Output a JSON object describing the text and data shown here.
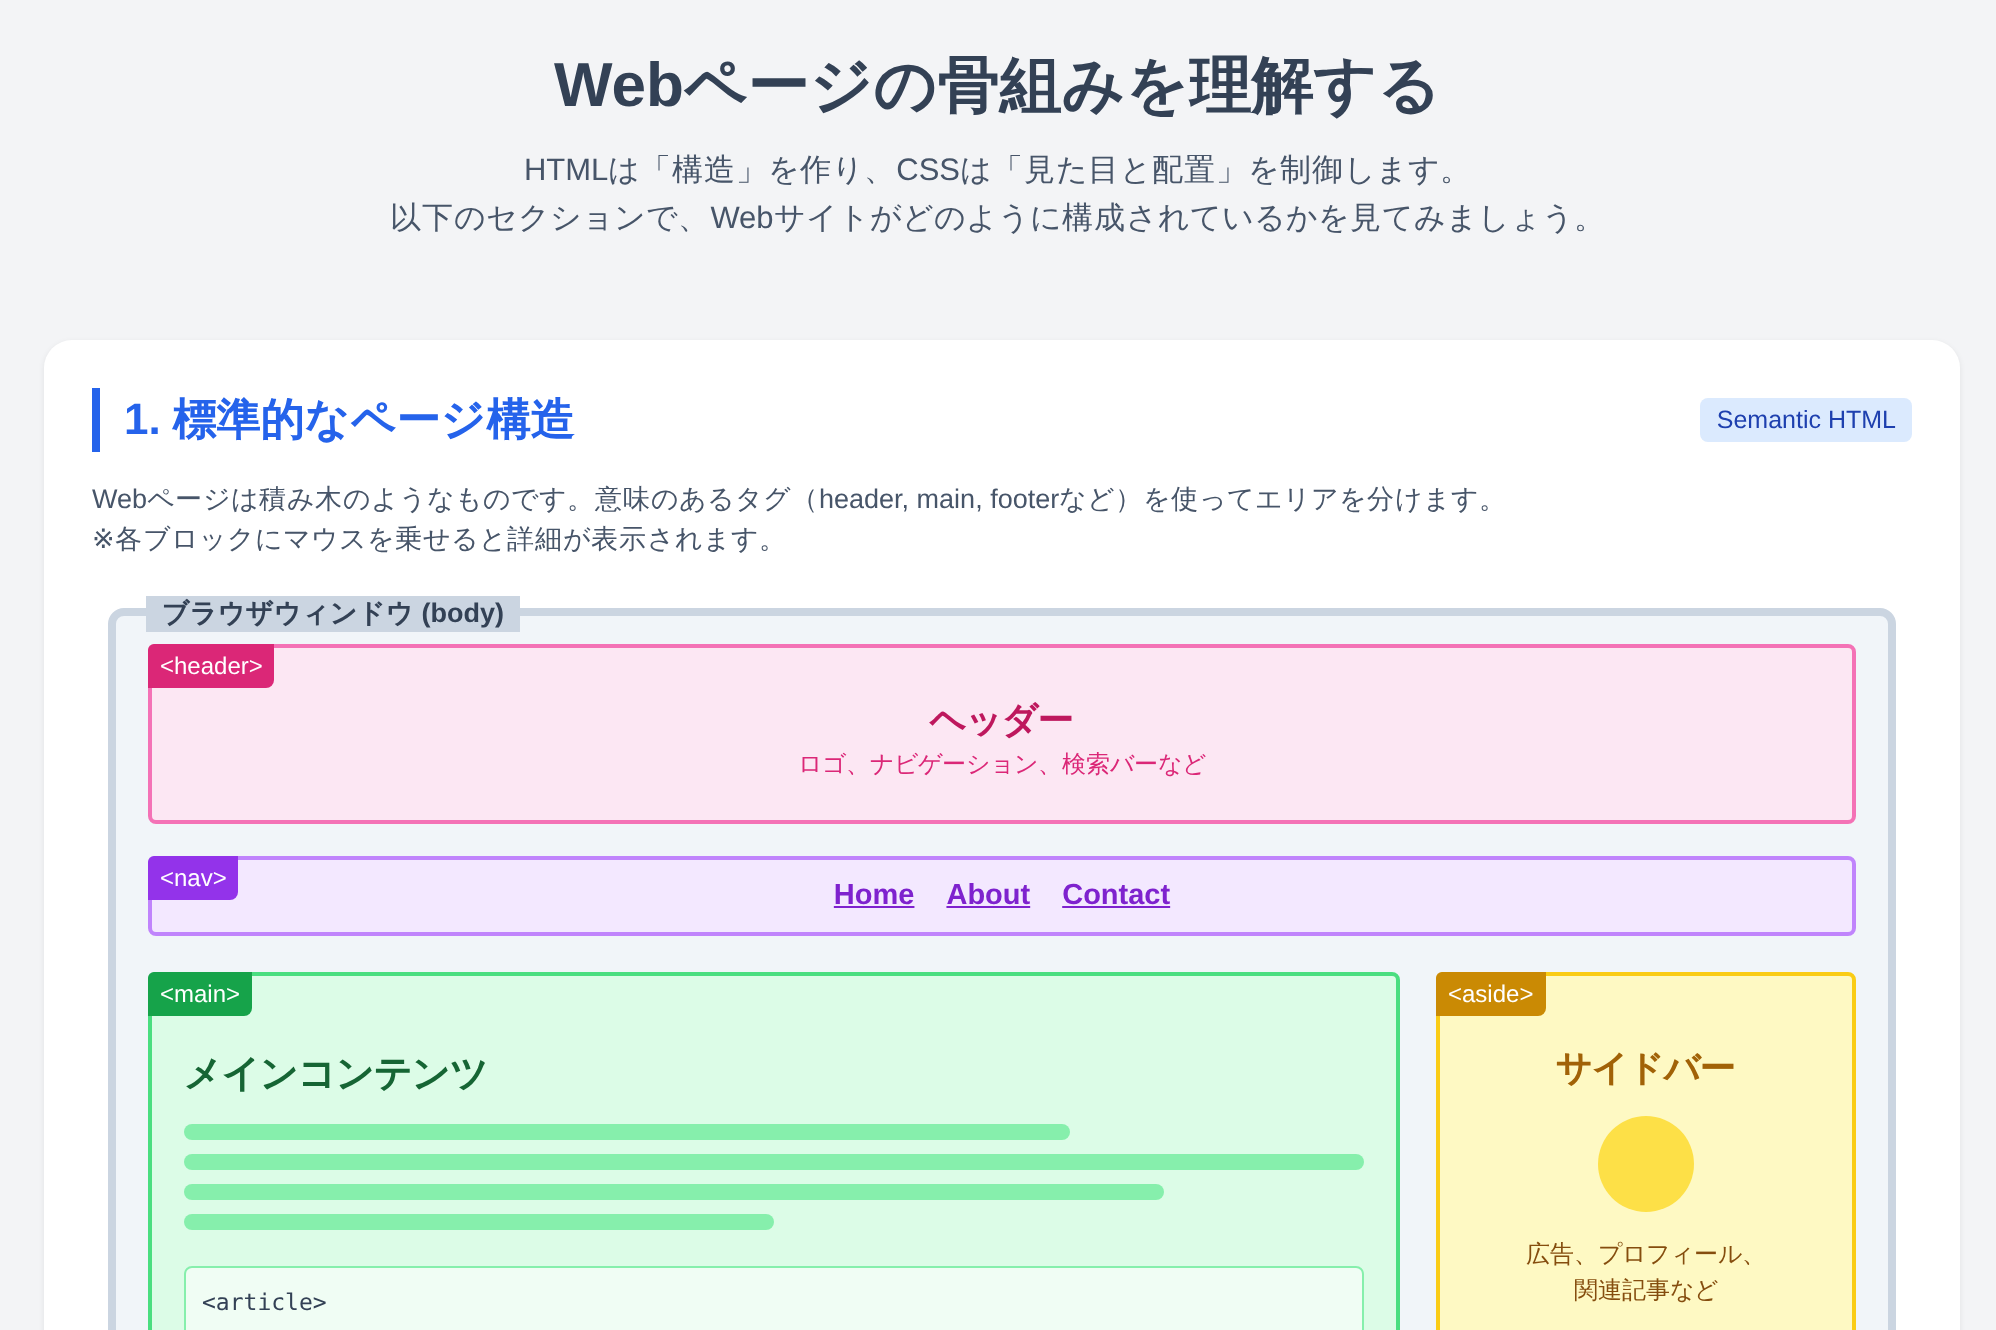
{
  "page": {
    "title": "Webページの骨組みを理解する",
    "subtitle_lines": [
      "HTMLは「構造」を作り、CSSは「見た目と配置」を制御します。",
      "以下のセクションで、Webサイトがどのように構成されているかを見てみましょう。"
    ]
  },
  "section": {
    "heading": "1. 標準的なページ構造",
    "badge": "Semantic HTML",
    "description_lines": [
      "Webページは積み木のようなものです。意味のあるタグ（header, main, footerなど）を使ってエリアを分けます。",
      "※各ブロックにマウスを乗せると詳細が表示されます。"
    ]
  },
  "diagram": {
    "body_label": "ブラウザウィンドウ (body)",
    "header": {
      "tag": "<header>",
      "title": "ヘッダー",
      "caption": "ロゴ、ナビゲーション、検索バーなど"
    },
    "nav": {
      "tag": "<nav>",
      "links": [
        "Home",
        "About",
        "Contact"
      ]
    },
    "main": {
      "tag": "<main>",
      "title": "メインコンテンツ",
      "article_tag": "<article>"
    },
    "aside": {
      "tag": "<aside>",
      "title": "サイドバー",
      "caption_lines": [
        "広告、プロフィール、",
        "関連記事など"
      ]
    }
  }
}
